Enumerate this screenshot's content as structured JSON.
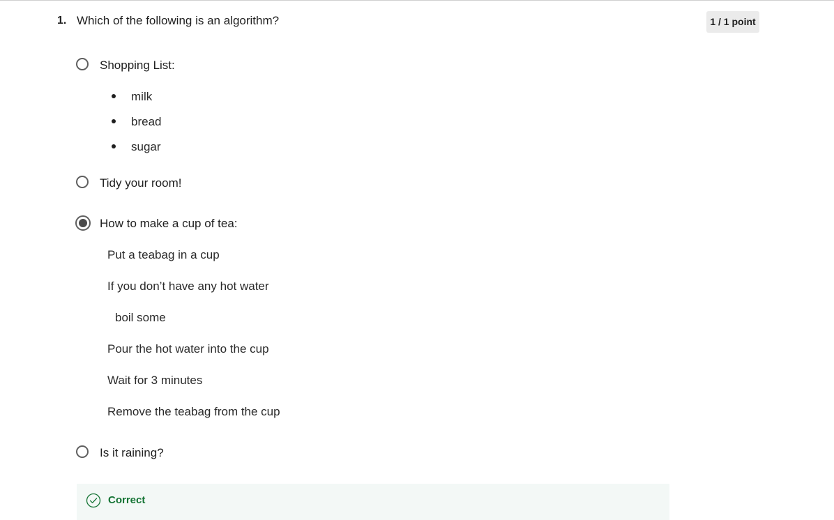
{
  "question": {
    "number": "1.",
    "text": "Which of the following is an algorithm?",
    "score": "1 / 1 point"
  },
  "options": [
    {
      "label": "Shopping List:",
      "selected": false,
      "bullets": [
        "milk",
        "bread",
        "sugar"
      ]
    },
    {
      "label": "Tidy your room!",
      "selected": false
    },
    {
      "label": "How to make a cup of tea:",
      "selected": true,
      "steps": [
        "Put a teabag in a cup",
        "If you don’t have any hot water",
        "boil some",
        "Pour the hot water into the cup",
        "Wait for 3 minutes",
        "Remove the teabag from the cup"
      ]
    },
    {
      "label": "Is it raining?",
      "selected": false
    }
  ],
  "feedback": {
    "status": "Correct",
    "icon": "check-circle-icon",
    "color": "#137333",
    "background": "#f3f8f6"
  }
}
